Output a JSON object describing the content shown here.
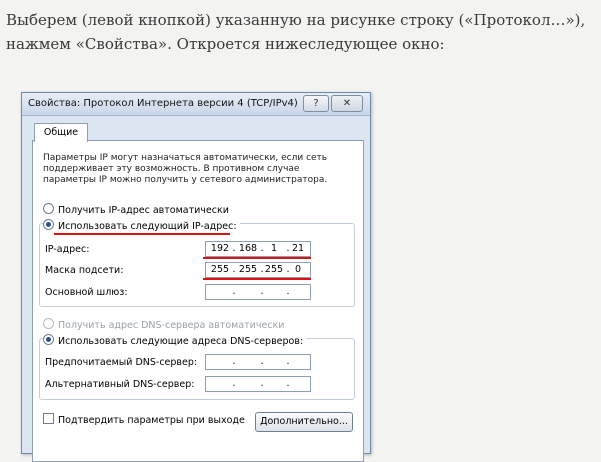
{
  "article": {
    "line1": "Выберем (левой кнопкой) указанную на рисунке строку («Протокол…»),",
    "line2": "нажмем «Свойства». Откроется нижеследующее окно:"
  },
  "dialog": {
    "title": "Свойства: Протокол Интернета версии 4 (TCP/IPv4)",
    "help_glyph": "?",
    "close_glyph": "✕",
    "tab_label": "Общие",
    "info_text": "Параметры IP могут назначаться автоматически, если сеть поддерживает эту возможность. В противном случае параметры IP можно получить у сетевого администратора.",
    "ip_auto_label": "Получить IP-адрес автоматически",
    "ip_manual_label": "Использовать следующий IP-адрес:",
    "ip_address_label": "IP-адрес:",
    "ip_address": [
      "192",
      "168",
      "1",
      "21"
    ],
    "subnet_label": "Маска подсети:",
    "subnet": [
      "255",
      "255",
      "255",
      "0"
    ],
    "gateway_label": "Основной шлюз:",
    "gateway": [
      "",
      "",
      "",
      ""
    ],
    "dns_auto_label": "Получить адрес DNS-сервера автоматически",
    "dns_manual_label": "Использовать следующие адреса DNS-серверов:",
    "dns_preferred_label": "Предпочитаемый DNS-сервер:",
    "dns_preferred": [
      "",
      "",
      "",
      ""
    ],
    "dns_alternate_label": "Альтернативный DNS-сервер:",
    "dns_alternate": [
      "",
      "",
      "",
      ""
    ],
    "validate_label": "Подтвердить параметры при выходе",
    "advanced_button": "Дополнительно..."
  },
  "colors": {
    "accent_underline": "#dd1111",
    "dialog_bg": "#dce6f2"
  }
}
